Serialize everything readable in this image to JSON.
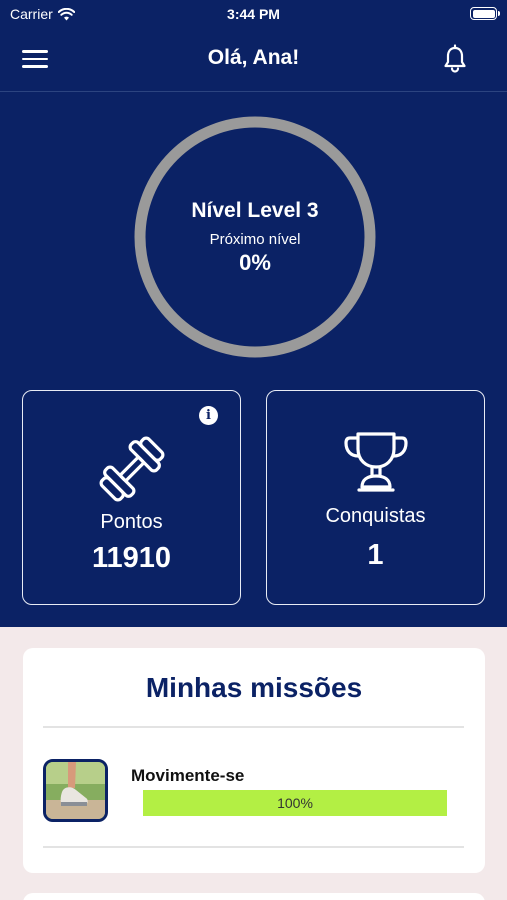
{
  "status_bar": {
    "carrier": "Carrier",
    "time": "3:44 PM"
  },
  "header": {
    "title": "Olá, Ana!"
  },
  "level": {
    "title": "Nível Level 3",
    "next_label": "Próximo nível",
    "progress": "0%"
  },
  "stats": {
    "points": {
      "label": "Pontos",
      "value": "11910",
      "info": "i"
    },
    "achievements": {
      "label": "Conquistas",
      "value": "1"
    }
  },
  "missions": {
    "title": "Minhas missões",
    "items": [
      {
        "name": "Movimente-se",
        "progress": "100%",
        "progress_fraction": 1.0
      }
    ]
  },
  "colors": {
    "primary": "#0b2265",
    "progress_green": "#b3ef44",
    "ring_gray": "#9a9a9a",
    "background": "#f3e9ea"
  }
}
